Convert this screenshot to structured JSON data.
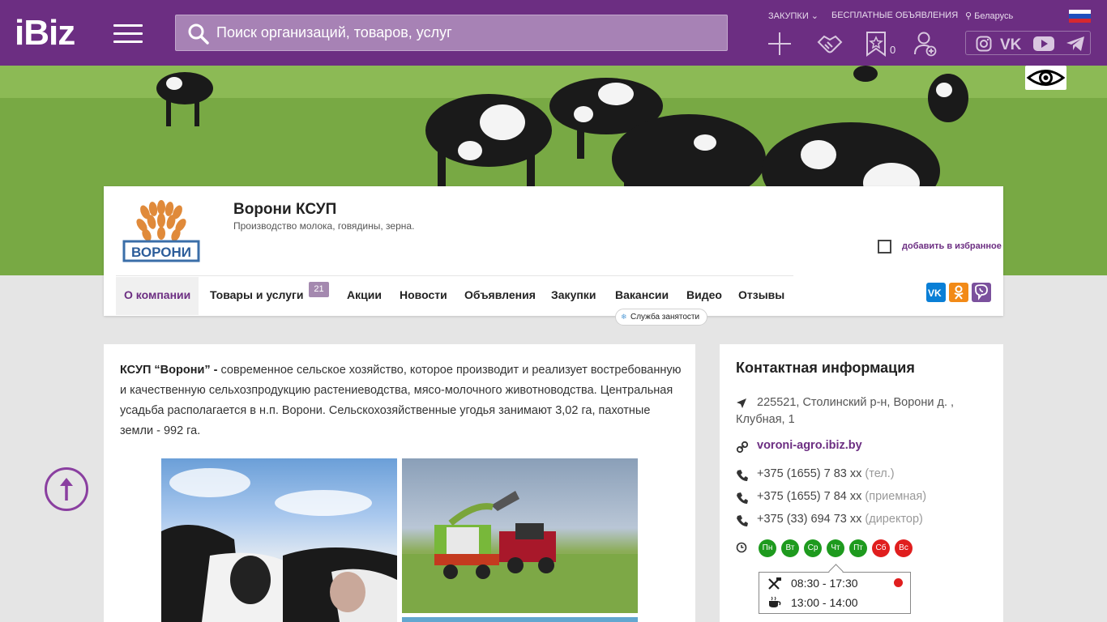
{
  "header": {
    "logo": "iBiz",
    "search_placeholder": "Поиск организаций, товаров, услуг",
    "nav": {
      "purchases": "ЗАКУПКИ",
      "classifieds": "БЕСПЛАТНЫЕ ОБЪЯВЛЕНИЯ",
      "region": "Беларусь"
    },
    "favorites_count": "0",
    "icons": [
      "plus-icon",
      "handshake-icon",
      "star-bookmark-icon",
      "add-user-icon"
    ],
    "socials": [
      "instagram-icon",
      "vk-icon",
      "youtube-icon",
      "telegram-icon"
    ]
  },
  "company": {
    "logo_text": "ВОРОНИ",
    "name": "Ворони КСУП",
    "description": "Производство молока, говядины, зерна.",
    "favorite_label": "добавить в избранное"
  },
  "tabs": [
    {
      "label": "О компании"
    },
    {
      "label": "Товары и услуги",
      "badge": "21"
    },
    {
      "label": "Акции"
    },
    {
      "label": "Новости"
    },
    {
      "label": "Объявления"
    },
    {
      "label": "Закупки"
    },
    {
      "label": "Вакансии"
    },
    {
      "label": "Видео"
    },
    {
      "label": "Отзывы"
    }
  ],
  "service_tip": "Служба занятости",
  "about": {
    "lead": "КСУП “Ворони” -",
    "text": " современное сельское хозяйство, которое производит и реализует востребованную и качественную сельхозпродукцию растениеводства, мясо-молочного животноводства. Центральная усадьба располагается в н.п.  Ворони. Сельскохозяйственные угодья занимают 3,02 га, пахотные земли - 992 га."
  },
  "contact": {
    "title": "Контактная информация",
    "address": "225521, Столинский р-н, Ворони д. , Клубная, 1",
    "website": "voroni-agro.ibiz.by",
    "phones": [
      {
        "number": "+375 (1655) 7 83 xx",
        "note": "(тел.)"
      },
      {
        "number": "+375 (1655) 7 84 xx",
        "note": "(приемная)"
      },
      {
        "number": "+375 (33) 694 73 xx",
        "note": "(директор)"
      }
    ],
    "days": [
      {
        "label": "Пн",
        "color": "#1e9a1e"
      },
      {
        "label": "Вт",
        "color": "#1e9a1e"
      },
      {
        "label": "Ср",
        "color": "#1e9a1e"
      },
      {
        "label": "Чт",
        "color": "#1e9a1e"
      },
      {
        "label": "Пт",
        "color": "#1e9a1e"
      },
      {
        "label": "Сб",
        "color": "#e01e1e"
      },
      {
        "label": "Вс",
        "color": "#e01e1e"
      }
    ],
    "work_hours": "08:30 - 17:30",
    "lunch_hours": "13:00 - 14:00"
  },
  "colors": {
    "brand": "#6c2e82",
    "open": "#1e9a1e",
    "closed": "#e01e1e"
  }
}
